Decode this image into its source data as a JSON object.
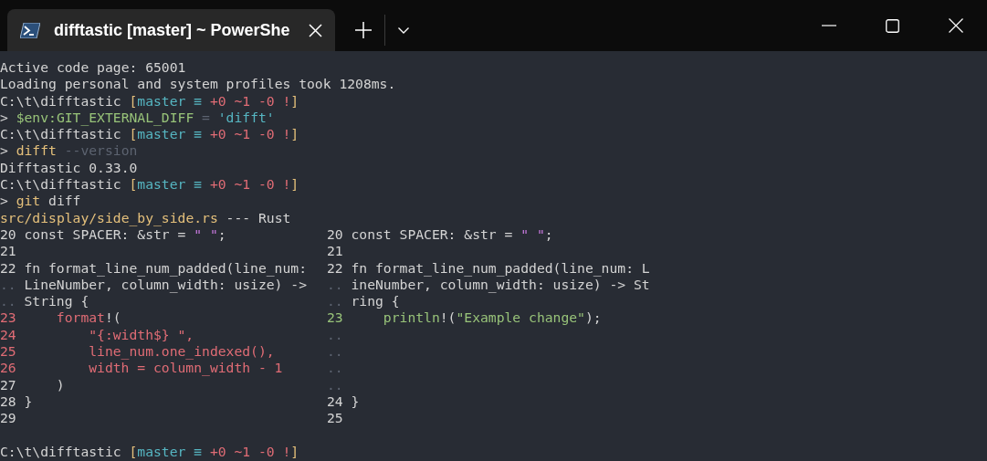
{
  "tab": {
    "title": "difftastic [master] ~ PowerShe"
  },
  "terminal": {
    "lines": [
      {
        "segments": [
          {
            "text": "Active code page: 65001",
            "kind": "plain"
          }
        ]
      },
      {
        "segments": [
          {
            "text": "Loading personal and system profiles took 1208ms.",
            "kind": "plain"
          }
        ]
      },
      {
        "segments": [
          {
            "text": "C:\\t\\difftastic ",
            "kind": "plain"
          },
          {
            "text": "[",
            "kind": "bracket"
          },
          {
            "text": "master ≡",
            "kind": "branch"
          },
          {
            "text": " +0 ~1 -0 !",
            "kind": "changes"
          },
          {
            "text": "]",
            "kind": "bracket"
          }
        ]
      },
      {
        "segments": [
          {
            "text": "> ",
            "kind": "plain"
          },
          {
            "text": "$env:GIT_EXTERNAL_DIFF",
            "kind": "variable"
          },
          {
            "text": " = ",
            "kind": "muted"
          },
          {
            "text": "'difft'",
            "kind": "branch"
          }
        ]
      },
      {
        "segments": [
          {
            "text": "C:\\t\\difftastic ",
            "kind": "plain"
          },
          {
            "text": "[",
            "kind": "bracket"
          },
          {
            "text": "master ≡",
            "kind": "branch"
          },
          {
            "text": " +0 ~1 -0 !",
            "kind": "changes"
          },
          {
            "text": "]",
            "kind": "bracket"
          }
        ]
      },
      {
        "segments": [
          {
            "text": "> ",
            "kind": "plain"
          },
          {
            "text": "difft",
            "kind": "bracket"
          },
          {
            "text": " --version",
            "kind": "muted"
          }
        ]
      },
      {
        "segments": [
          {
            "text": "Difftastic 0.33.0",
            "kind": "plain"
          }
        ]
      },
      {
        "segments": [
          {
            "text": "C:\\t\\difftastic ",
            "kind": "plain"
          },
          {
            "text": "[",
            "kind": "bracket"
          },
          {
            "text": "master ≡",
            "kind": "branch"
          },
          {
            "text": " +0 ~1 -0 !",
            "kind": "changes"
          },
          {
            "text": "]",
            "kind": "bracket"
          }
        ]
      },
      {
        "segments": [
          {
            "text": "> ",
            "kind": "plain"
          },
          {
            "text": "git",
            "kind": "bracket"
          },
          {
            "text": " diff",
            "kind": "plain"
          }
        ]
      },
      {
        "segments": [
          {
            "text": "src/display/side_by_side.rs",
            "kind": "bracket"
          },
          {
            "text": " --- Rust",
            "kind": "plain"
          }
        ]
      }
    ],
    "diff_rows": [
      {
        "left": {
          "number": {
            "text": "20",
            "kind": "plain"
          },
          "segments": [
            {
              "text": "const SPACER: &str = ",
              "kind": "plain"
            },
            {
              "text": "\" \"",
              "kind": "literal"
            },
            {
              "text": ";",
              "kind": "plain"
            }
          ]
        },
        "right": {
          "number": {
            "text": "20",
            "kind": "plain"
          },
          "segments": [
            {
              "text": "const SPACER: &str = ",
              "kind": "plain"
            },
            {
              "text": "\" \"",
              "kind": "literal"
            },
            {
              "text": ";",
              "kind": "plain"
            }
          ]
        }
      },
      {
        "left": {
          "number": {
            "text": "21",
            "kind": "plain"
          }
        },
        "right": {
          "number": {
            "text": "21",
            "kind": "plain"
          }
        }
      },
      {
        "left": {
          "number": {
            "text": "22",
            "kind": "plain"
          },
          "segments": [
            {
              "text": "fn format_line_num_padded(line_num:",
              "kind": "plain"
            }
          ]
        },
        "right": {
          "number": {
            "text": "22",
            "kind": "plain"
          },
          "segments": [
            {
              "text": "fn format_line_num_padded(line_num: L",
              "kind": "plain"
            }
          ]
        }
      },
      {
        "left": {
          "number": {
            "text": "..",
            "kind": "muted"
          },
          "segments": [
            {
              "text": "LineNumber, column_width: usize) ->",
              "kind": "plain"
            }
          ]
        },
        "right": {
          "number": {
            "text": "..",
            "kind": "muted"
          },
          "segments": [
            {
              "text": "ineNumber, column_width: usize) -> St",
              "kind": "plain"
            }
          ]
        }
      },
      {
        "left": {
          "number": {
            "text": "..",
            "kind": "muted"
          },
          "segments": [
            {
              "text": "String {",
              "kind": "plain"
            }
          ]
        },
        "right": {
          "number": {
            "text": "..",
            "kind": "muted"
          },
          "segments": [
            {
              "text": "ring {",
              "kind": "plain"
            }
          ]
        }
      },
      {
        "left": {
          "number": {
            "text": "23",
            "kind": "removed"
          },
          "segments": [
            {
              "text": "    format",
              "kind": "removed"
            },
            {
              "text": "!(",
              "kind": "plain"
            }
          ]
        },
        "right": {
          "number": {
            "text": "23",
            "kind": "added"
          },
          "segments": [
            {
              "text": "    println",
              "kind": "added"
            },
            {
              "text": "!(",
              "kind": "plain"
            },
            {
              "text": "\"Example change\"",
              "kind": "added"
            },
            {
              "text": ");",
              "kind": "plain"
            }
          ]
        }
      },
      {
        "left": {
          "number": {
            "text": "24",
            "kind": "removed"
          },
          "segments": [
            {
              "text": "        \"{:width$} \",",
              "kind": "removed"
            }
          ]
        },
        "right": {
          "number": {
            "text": "..",
            "kind": "muted"
          }
        }
      },
      {
        "left": {
          "number": {
            "text": "25",
            "kind": "removed"
          },
          "segments": [
            {
              "text": "        line_num.one_indexed(),",
              "kind": "removed"
            }
          ]
        },
        "right": {
          "number": {
            "text": "..",
            "kind": "muted"
          }
        }
      },
      {
        "left": {
          "number": {
            "text": "26",
            "kind": "removed"
          },
          "segments": [
            {
              "text": "        width = column_width - 1",
              "kind": "removed"
            }
          ]
        },
        "right": {
          "number": {
            "text": "..",
            "kind": "muted"
          }
        }
      },
      {
        "left": {
          "number": {
            "text": "27",
            "kind": "plain"
          },
          "segments": [
            {
              "text": "    )",
              "kind": "plain"
            }
          ]
        },
        "right": {
          "number": {
            "text": "..",
            "kind": "muted"
          }
        }
      },
      {
        "left": {
          "number": {
            "text": "28",
            "kind": "plain"
          },
          "segments": [
            {
              "text": "}",
              "kind": "plain"
            }
          ]
        },
        "right": {
          "number": {
            "text": "24",
            "kind": "plain"
          },
          "segments": [
            {
              "text": "}",
              "kind": "plain"
            }
          ]
        }
      },
      {
        "left": {
          "number": {
            "text": "29",
            "kind": "plain"
          }
        },
        "right": {
          "number": {
            "text": "25",
            "kind": "plain"
          }
        }
      }
    ],
    "after_lines": [
      {
        "segments": [
          {
            "text": "C:\\t\\difftastic ",
            "kind": "plain"
          },
          {
            "text": "[",
            "kind": "bracket"
          },
          {
            "text": "master ≡",
            "kind": "branch"
          },
          {
            "text": " +0 ~1 -0 !",
            "kind": "changes"
          },
          {
            "text": "]",
            "kind": "bracket"
          }
        ]
      }
    ]
  }
}
